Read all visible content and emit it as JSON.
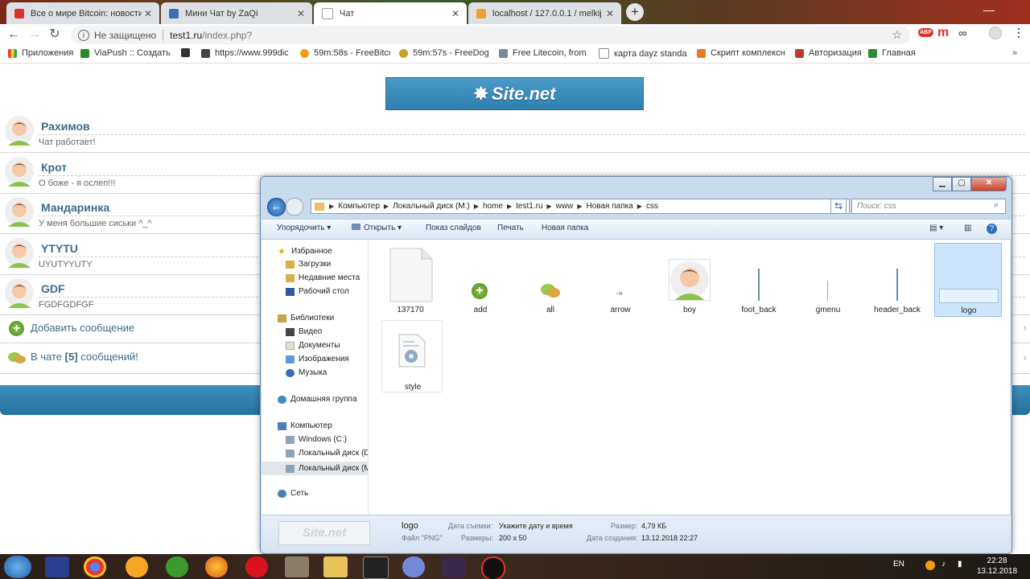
{
  "browser": {
    "tabs": [
      {
        "label": "Все о мире Bitcoin: новости, со",
        "color": "#d9342b",
        "active": false
      },
      {
        "label": "Мини Чат by ZaQi",
        "color": "#3b6fb6",
        "active": false
      },
      {
        "label": "Чат",
        "color": "#ffffff",
        "active": true
      },
      {
        "label": "localhost / 127.0.0.1 / melkij | ph",
        "color": "#f0a030",
        "active": false
      }
    ],
    "new_tab": "+",
    "insecure_label": "Не защищено",
    "url_host": "test1.ru",
    "url_path": "/index.php?",
    "extensions": {
      "abp": "ABP",
      "m": "m",
      "oo": "∞"
    },
    "bookmarks": [
      {
        "label": "Приложения",
        "color": "#e33"
      },
      {
        "label": "ViaPush :: Создать р",
        "color": "#2a8a2a"
      },
      {
        "label": "",
        "color": "#333"
      },
      {
        "label": "https://www.999dice",
        "color": "#444"
      },
      {
        "label": "59m:58s - FreeBitco.",
        "color": "#f39c12"
      },
      {
        "label": "59m:57s - FreeDoge.",
        "color": "#c9a227"
      },
      {
        "label": "Free Litecoin, from C",
        "color": "#7a8a99"
      },
      {
        "label": "карта dayz standalo",
        "color": "#888"
      },
      {
        "label": "Скрипт комплексно",
        "color": "#e67e22"
      },
      {
        "label": "Авторизация",
        "color": "#c0392b"
      },
      {
        "label": "Главная",
        "color": "#2c8a3a"
      }
    ]
  },
  "chat": {
    "logo_text": "Site.net",
    "messages": [
      {
        "name": "Рахимов",
        "text": "Чат работает!"
      },
      {
        "name": "Крот",
        "text": "О боже - я ослеп!!!"
      },
      {
        "name": "Мандаринка",
        "text": "У меня большие сиськи ^_^"
      },
      {
        "name": "YTYTU",
        "text": "UYUTYYUTY"
      },
      {
        "name": "GDF",
        "text": "FGDFGDFGF"
      }
    ],
    "add_message": "Добавить сообщение",
    "count_prefix": "В чате",
    "count_value": "[5]",
    "count_suffix": "сообщений!"
  },
  "explorer": {
    "breadcrumbs": [
      "Компьютер",
      "Локальный диск (M:)",
      "home",
      "test1.ru",
      "www",
      "Новая папка",
      "css"
    ],
    "search_placeholder": "Поиск: css",
    "commands": [
      "Упорядочить",
      "Открыть",
      "Показ слайдов",
      "Печать",
      "Новая папка"
    ],
    "nav": {
      "favorites": "Избранное",
      "fav_items": [
        "Загрузки",
        "Недавние места",
        "Рабочий стол"
      ],
      "libraries": "Библиотеки",
      "lib_items": [
        "Видео",
        "Документы",
        "Изображения",
        "Музыка"
      ],
      "homegroup": "Домашняя группа",
      "computer": "Компьютер",
      "comp_items": [
        "Windows (C:)",
        "Локальный диск (D",
        "Локальный диск (M"
      ],
      "network": "Сеть"
    },
    "files": [
      "137170",
      "add",
      "all",
      "arrow",
      "boy",
      "foot_back",
      "gmenu",
      "header_back",
      "logo",
      "style"
    ],
    "details": {
      "name": "logo",
      "type": "Файл \"PNG\"",
      "date_taken_label": "Дата съемки:",
      "date_taken_value": "Укажите дату и время",
      "dims_label": "Размеры:",
      "dims_value": "200 x 50",
      "size_label": "Размер:",
      "size_value": "4,79 КБ",
      "created_label": "Дата создания:",
      "created_value": "13.12.2018 22:27",
      "thumb_text": "Site.net"
    }
  },
  "taskbar": {
    "lang": "EN",
    "time": "22:28",
    "date": "13.12.2018"
  }
}
